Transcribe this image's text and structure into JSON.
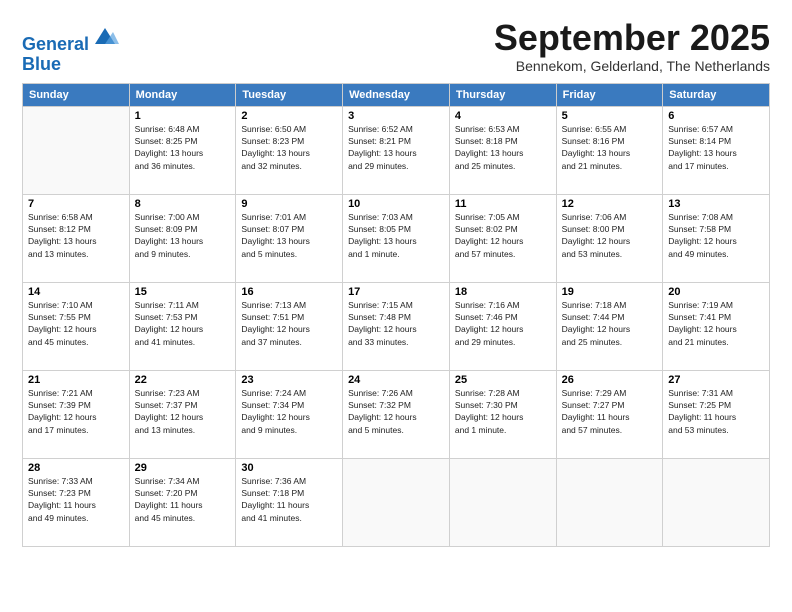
{
  "logo": {
    "line1": "General",
    "line2": "Blue"
  },
  "title": "September 2025",
  "subtitle": "Bennekom, Gelderland, The Netherlands",
  "days_header": [
    "Sunday",
    "Monday",
    "Tuesday",
    "Wednesday",
    "Thursday",
    "Friday",
    "Saturday"
  ],
  "weeks": [
    [
      {
        "num": "",
        "info": ""
      },
      {
        "num": "1",
        "info": "Sunrise: 6:48 AM\nSunset: 8:25 PM\nDaylight: 13 hours\nand 36 minutes."
      },
      {
        "num": "2",
        "info": "Sunrise: 6:50 AM\nSunset: 8:23 PM\nDaylight: 13 hours\nand 32 minutes."
      },
      {
        "num": "3",
        "info": "Sunrise: 6:52 AM\nSunset: 8:21 PM\nDaylight: 13 hours\nand 29 minutes."
      },
      {
        "num": "4",
        "info": "Sunrise: 6:53 AM\nSunset: 8:18 PM\nDaylight: 13 hours\nand 25 minutes."
      },
      {
        "num": "5",
        "info": "Sunrise: 6:55 AM\nSunset: 8:16 PM\nDaylight: 13 hours\nand 21 minutes."
      },
      {
        "num": "6",
        "info": "Sunrise: 6:57 AM\nSunset: 8:14 PM\nDaylight: 13 hours\nand 17 minutes."
      }
    ],
    [
      {
        "num": "7",
        "info": "Sunrise: 6:58 AM\nSunset: 8:12 PM\nDaylight: 13 hours\nand 13 minutes."
      },
      {
        "num": "8",
        "info": "Sunrise: 7:00 AM\nSunset: 8:09 PM\nDaylight: 13 hours\nand 9 minutes."
      },
      {
        "num": "9",
        "info": "Sunrise: 7:01 AM\nSunset: 8:07 PM\nDaylight: 13 hours\nand 5 minutes."
      },
      {
        "num": "10",
        "info": "Sunrise: 7:03 AM\nSunset: 8:05 PM\nDaylight: 13 hours\nand 1 minute."
      },
      {
        "num": "11",
        "info": "Sunrise: 7:05 AM\nSunset: 8:02 PM\nDaylight: 12 hours\nand 57 minutes."
      },
      {
        "num": "12",
        "info": "Sunrise: 7:06 AM\nSunset: 8:00 PM\nDaylight: 12 hours\nand 53 minutes."
      },
      {
        "num": "13",
        "info": "Sunrise: 7:08 AM\nSunset: 7:58 PM\nDaylight: 12 hours\nand 49 minutes."
      }
    ],
    [
      {
        "num": "14",
        "info": "Sunrise: 7:10 AM\nSunset: 7:55 PM\nDaylight: 12 hours\nand 45 minutes."
      },
      {
        "num": "15",
        "info": "Sunrise: 7:11 AM\nSunset: 7:53 PM\nDaylight: 12 hours\nand 41 minutes."
      },
      {
        "num": "16",
        "info": "Sunrise: 7:13 AM\nSunset: 7:51 PM\nDaylight: 12 hours\nand 37 minutes."
      },
      {
        "num": "17",
        "info": "Sunrise: 7:15 AM\nSunset: 7:48 PM\nDaylight: 12 hours\nand 33 minutes."
      },
      {
        "num": "18",
        "info": "Sunrise: 7:16 AM\nSunset: 7:46 PM\nDaylight: 12 hours\nand 29 minutes."
      },
      {
        "num": "19",
        "info": "Sunrise: 7:18 AM\nSunset: 7:44 PM\nDaylight: 12 hours\nand 25 minutes."
      },
      {
        "num": "20",
        "info": "Sunrise: 7:19 AM\nSunset: 7:41 PM\nDaylight: 12 hours\nand 21 minutes."
      }
    ],
    [
      {
        "num": "21",
        "info": "Sunrise: 7:21 AM\nSunset: 7:39 PM\nDaylight: 12 hours\nand 17 minutes."
      },
      {
        "num": "22",
        "info": "Sunrise: 7:23 AM\nSunset: 7:37 PM\nDaylight: 12 hours\nand 13 minutes."
      },
      {
        "num": "23",
        "info": "Sunrise: 7:24 AM\nSunset: 7:34 PM\nDaylight: 12 hours\nand 9 minutes."
      },
      {
        "num": "24",
        "info": "Sunrise: 7:26 AM\nSunset: 7:32 PM\nDaylight: 12 hours\nand 5 minutes."
      },
      {
        "num": "25",
        "info": "Sunrise: 7:28 AM\nSunset: 7:30 PM\nDaylight: 12 hours\nand 1 minute."
      },
      {
        "num": "26",
        "info": "Sunrise: 7:29 AM\nSunset: 7:27 PM\nDaylight: 11 hours\nand 57 minutes."
      },
      {
        "num": "27",
        "info": "Sunrise: 7:31 AM\nSunset: 7:25 PM\nDaylight: 11 hours\nand 53 minutes."
      }
    ],
    [
      {
        "num": "28",
        "info": "Sunrise: 7:33 AM\nSunset: 7:23 PM\nDaylight: 11 hours\nand 49 minutes."
      },
      {
        "num": "29",
        "info": "Sunrise: 7:34 AM\nSunset: 7:20 PM\nDaylight: 11 hours\nand 45 minutes."
      },
      {
        "num": "30",
        "info": "Sunrise: 7:36 AM\nSunset: 7:18 PM\nDaylight: 11 hours\nand 41 minutes."
      },
      {
        "num": "",
        "info": ""
      },
      {
        "num": "",
        "info": ""
      },
      {
        "num": "",
        "info": ""
      },
      {
        "num": "",
        "info": ""
      }
    ]
  ]
}
